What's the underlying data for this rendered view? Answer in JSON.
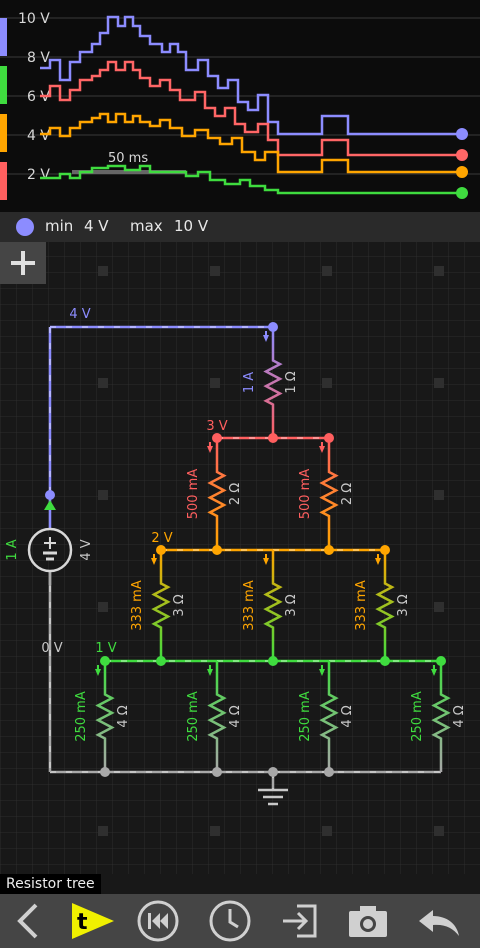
{
  "scope": {
    "y_labels": [
      "10 V",
      "8 V",
      "6 V",
      "4 V",
      "2 V"
    ],
    "time_label": "50 ms",
    "traces": [
      {
        "name": "4 V node",
        "color": "#8c8cff"
      },
      {
        "name": "3 V node",
        "color": "#ff5f5f"
      },
      {
        "name": "2 V node",
        "color": "#ffa500"
      },
      {
        "name": "1 V node",
        "color": "#3fdc3f"
      }
    ]
  },
  "scope_bar": {
    "min_label": "min",
    "min_value": "4 V",
    "max_label": "max",
    "max_value": "10 V",
    "dot_color": "#8c8cff"
  },
  "add_button": {
    "icon": "plus-icon"
  },
  "circuit": {
    "source": {
      "current": "1 A",
      "voltage": "4 V"
    },
    "node_labels": {
      "n4": "4 V",
      "n3": "3 V",
      "n2": "2 V",
      "n1": "1 V",
      "n0": "0 V"
    },
    "level1": [
      {
        "current": "1 A",
        "resistance": "1 Ω"
      }
    ],
    "level2": [
      {
        "current": "500 mA",
        "resistance": "2 Ω"
      },
      {
        "current": "500 mA",
        "resistance": "2 Ω"
      }
    ],
    "level3": [
      {
        "current": "333 mA",
        "resistance": "3 Ω"
      },
      {
        "current": "333 mA",
        "resistance": "3 Ω"
      },
      {
        "current": "333 mA",
        "resistance": "3 Ω"
      }
    ],
    "level4": [
      {
        "current": "250 mA",
        "resistance": "4 Ω"
      },
      {
        "current": "250 mA",
        "resistance": "4 Ω"
      },
      {
        "current": "250 mA",
        "resistance": "4 Ω"
      },
      {
        "current": "250 mA",
        "resistance": "4 Ω"
      }
    ]
  },
  "circuit_title": "Resistor tree",
  "toolbar": [
    {
      "name": "back-icon"
    },
    {
      "name": "text-tool-icon"
    },
    {
      "name": "rewind-icon"
    },
    {
      "name": "clock-icon"
    },
    {
      "name": "export-icon"
    },
    {
      "name": "camera-icon"
    },
    {
      "name": "undo-icon"
    }
  ]
}
